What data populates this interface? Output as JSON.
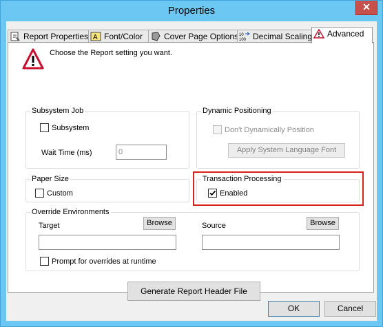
{
  "window": {
    "title": "Properties",
    "close_glyph": "✕"
  },
  "tabs": [
    {
      "label": "Report Properties",
      "icon": "report-properties-icon"
    },
    {
      "label": "Font/Color",
      "icon": "font-color-icon"
    },
    {
      "label": "Cover Page Options",
      "icon": "cover-page-icon"
    },
    {
      "label": "Decimal Scaling",
      "icon": "decimal-scaling-icon"
    },
    {
      "label": "Advanced",
      "icon": "warning-icon",
      "active": true
    }
  ],
  "header": {
    "instruction": "Choose the Report setting you want."
  },
  "subsystem_job": {
    "title": "Subsystem Job",
    "checkbox_label": "Subsystem",
    "checked": false,
    "wait_time_label": "Wait Time (ms)",
    "wait_time_value": "0"
  },
  "dynamic_positioning": {
    "title": "Dynamic Positioning",
    "checkbox_label": "Don't Dynamically Position",
    "checked": false,
    "button_label": "Apply System Language Font"
  },
  "paper_size": {
    "title": "Paper Size",
    "checkbox_label": "Custom",
    "checked": false
  },
  "transaction_processing": {
    "title": "Transaction Processing",
    "checkbox_label": "Enabled",
    "checked": true,
    "highlight_color": "#d9221b"
  },
  "override_environments": {
    "title": "Override Environments",
    "target_label": "Target",
    "target_value": "",
    "source_label": "Source",
    "source_value": "",
    "browse_label": "Browse",
    "prompt_label": "Prompt for overrides at runtime",
    "prompt_checked": false
  },
  "generate_button": "Generate Report Header File",
  "footer": {
    "ok": "OK",
    "cancel": "Cancel"
  },
  "colors": {
    "titlebar": "#6cc7f2",
    "close": "#c7504a",
    "warning_red": "#c8102e"
  }
}
